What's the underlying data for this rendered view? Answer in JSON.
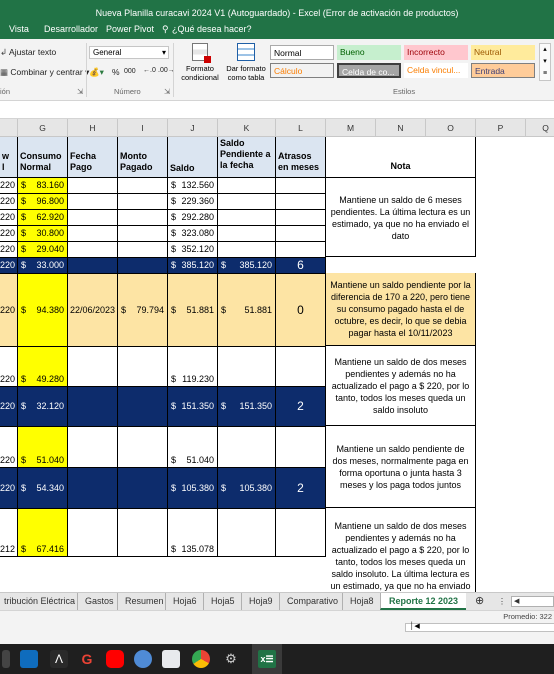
{
  "window": {
    "title": "Nueva Planilla curacavi 2024 V1 (Autoguardado) - Excel (Error de activación de productos)"
  },
  "ribbon_tabs": [
    "Vista",
    "Desarrollador",
    "Power Pivot"
  ],
  "tell_me": "¿Qué desea hacer?",
  "ribbon": {
    "wrap_text": "Ajustar texto",
    "merge_center": "Combinar y centrar",
    "alignment_group": "ión",
    "number_format": "General",
    "percent": "%",
    "thousands": "000",
    "number_group": "Número",
    "conditional_format": "Formato condicional",
    "format_as_table": "Dar formato como tabla",
    "styles_group": "Estilos",
    "styles": [
      {
        "label": "Normal",
        "bg": "#ffffff",
        "fg": "#000000"
      },
      {
        "label": "Bueno",
        "bg": "#c6efce",
        "fg": "#006100"
      },
      {
        "label": "Incorrecto",
        "bg": "#ffc7ce",
        "fg": "#9c0006"
      },
      {
        "label": "Neutral",
        "bg": "#ffeb9c",
        "fg": "#9c5700"
      },
      {
        "label": "Cálculo",
        "bg": "#f2f2f2",
        "fg": "#fa7d00"
      },
      {
        "label": "Celda de co...",
        "bg": "#a5a5a5",
        "fg": "#ffffff"
      },
      {
        "label": "Celda vincul...",
        "bg": "#ffffff",
        "fg": "#fa7d00"
      },
      {
        "label": "Entrada",
        "bg": "#ffcc99",
        "fg": "#3f3f76"
      }
    ]
  },
  "columns": [
    "G",
    "H",
    "I",
    "J",
    "K",
    "L",
    "M",
    "N",
    "O",
    "P",
    "Q"
  ],
  "headers": {
    "f": "w\nl",
    "g": "Consumo Normal",
    "h": "Fecha Pago",
    "i": "Monto Pagado",
    "j": "Saldo",
    "k": "Saldo Pendiente a la fecha",
    "l": "Atrasos en meses",
    "nota": "Nota"
  },
  "currency_symbol": "$",
  "rows": [
    {
      "f": "220",
      "g": "83.160",
      "h": "",
      "i": "",
      "j": "132.560",
      "k": "",
      "l": ""
    },
    {
      "f": "220",
      "g": "96.800",
      "h": "",
      "i": "",
      "j": "229.360",
      "k": "",
      "l": ""
    },
    {
      "f": "220",
      "g": "62.920",
      "h": "",
      "i": "",
      "j": "292.280",
      "k": "",
      "l": ""
    },
    {
      "f": "220",
      "g": "30.800",
      "h": "",
      "i": "",
      "j": "323.080",
      "k": "",
      "l": ""
    },
    {
      "f": "220",
      "g": "29.040",
      "h": "",
      "i": "",
      "j": "352.120",
      "k": "",
      "l": ""
    },
    {
      "f": "220",
      "g": "33.000",
      "h": "",
      "i": "",
      "j": "385.120",
      "k": "385.120",
      "l": "6"
    },
    {
      "f": "220",
      "g": "94.380",
      "h": "22/06/2023",
      "i": "79.794",
      "j": "51.881",
      "k": "51.881",
      "l": "0"
    },
    {
      "f": "220",
      "g": "49.280",
      "h": "",
      "i": "",
      "j": "119.230",
      "k": "",
      "l": ""
    },
    {
      "f": "220",
      "g": "32.120",
      "h": "",
      "i": "",
      "j": "151.350",
      "k": "151.350",
      "l": "2"
    },
    {
      "f": "220",
      "g": "51.040",
      "h": "",
      "i": "",
      "j": "51.040",
      "k": "",
      "l": ""
    },
    {
      "f": "220",
      "g": "54.340",
      "h": "",
      "i": "",
      "j": "105.380",
      "k": "105.380",
      "l": "2"
    },
    {
      "f": "212",
      "g": "67.416",
      "h": "",
      "i": "",
      "j": "135.078",
      "k": "",
      "l": ""
    }
  ],
  "notes": [
    "Mantiene un saldo de 6 meses pendientes. La última lectura es un estimado, ya que no ha enviado el dato",
    "Mantiene un saldo pendiente por la diferencia de 170 a 220, pero tiene su consumo pagado hasta el de octubre, es decir, lo que se debia pagar hasta el 10/11/2023",
    "Mantiene un saldo de dos meses pendientes y además no ha actualizado el pago a $ 220, por lo tanto, todos los meses queda un saldo insoluto",
    "Mantiene un saldo pendiente de dos meses, normalmente paga en forma oportuna o junta hasta 3 meses y los paga todos juntos",
    "Mantiene un saldo de dos meses pendientes y además no ha actualizado el pago a $ 220, por lo tanto, todos los meses queda un saldo insoluto. La última lectura es un estimado, ya que no ha enviado el"
  ],
  "sheet_tabs": [
    "tribución Eléctrica",
    "Gastos",
    "Resumen",
    "Hoja6",
    "Hoja5",
    "Hoja9",
    "Comparativo",
    "Hoja8",
    "Reporte 12 2023"
  ],
  "active_tab": "Reporte 12 2023",
  "status": {
    "average": "Promedio: 322"
  },
  "colors": {
    "excel_green": "#217346",
    "navy": "#0d2c6c",
    "yellow": "#ffff00",
    "peach": "#fde4a4",
    "header_blue": "#dbe5f1"
  }
}
